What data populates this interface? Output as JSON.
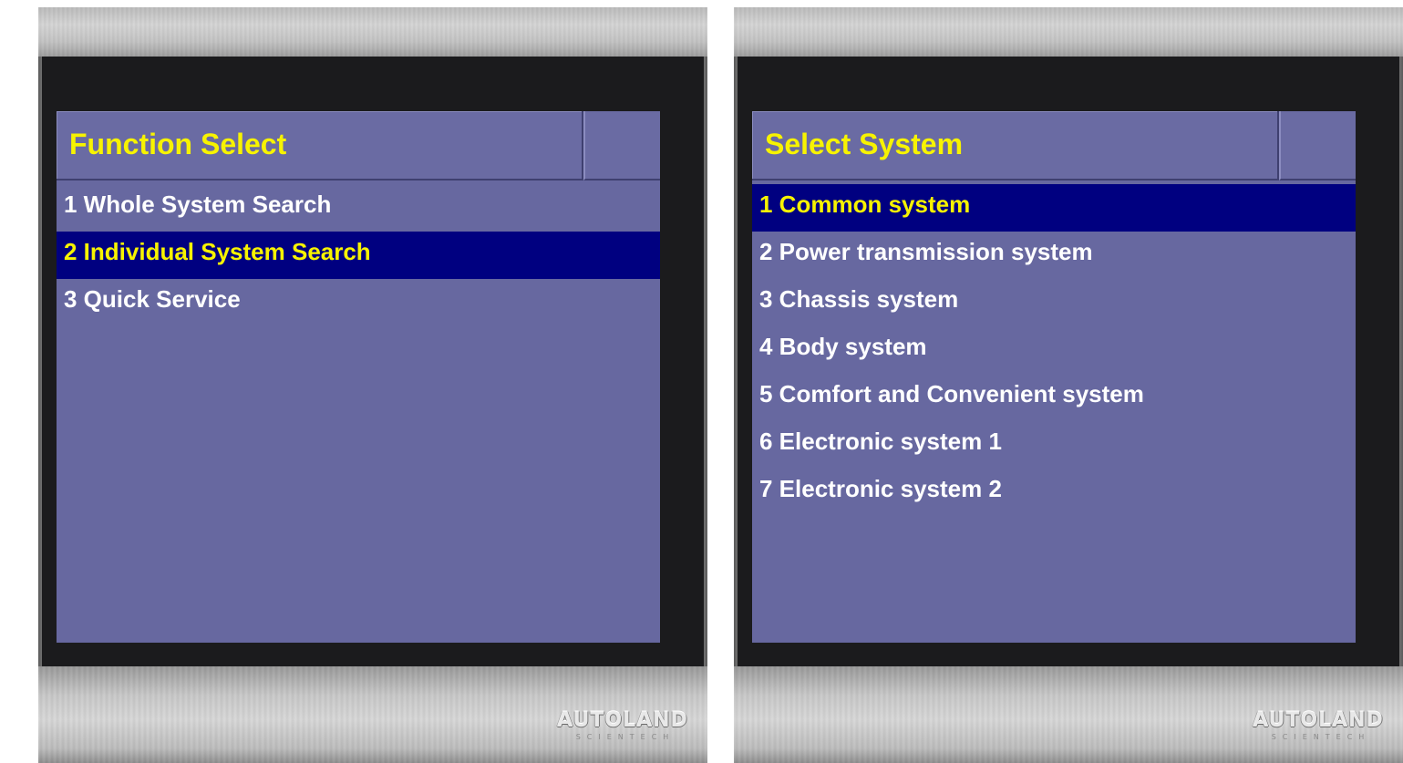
{
  "panels": [
    {
      "title": "Function Select",
      "items": [
        {
          "label": "1 Whole System Search",
          "selected": false
        },
        {
          "label": "2 Individual System Search",
          "selected": true
        },
        {
          "label": "3 Quick Service",
          "selected": false
        }
      ],
      "brand": {
        "name": "AUTOLAND",
        "subtitle": "SCIENTECH"
      }
    },
    {
      "title": "Select System",
      "items": [
        {
          "label": "1 Common system",
          "selected": true
        },
        {
          "label": "2 Power transmission system",
          "selected": false
        },
        {
          "label": "3 Chassis system",
          "selected": false
        },
        {
          "label": "4 Body system",
          "selected": false
        },
        {
          "label": "5 Comfort and Convenient system",
          "selected": false
        },
        {
          "label": "6 Electronic system 1",
          "selected": false
        },
        {
          "label": "7 Electronic system 2",
          "selected": false
        }
      ],
      "brand": {
        "name": "AUTOLAND",
        "subtitle": "SCIENTECH"
      }
    }
  ],
  "colors": {
    "screen_bg": "#6768a0",
    "selected_bg": "#000080",
    "highlight_text": "#f7f300",
    "item_text": "#ffffff"
  }
}
